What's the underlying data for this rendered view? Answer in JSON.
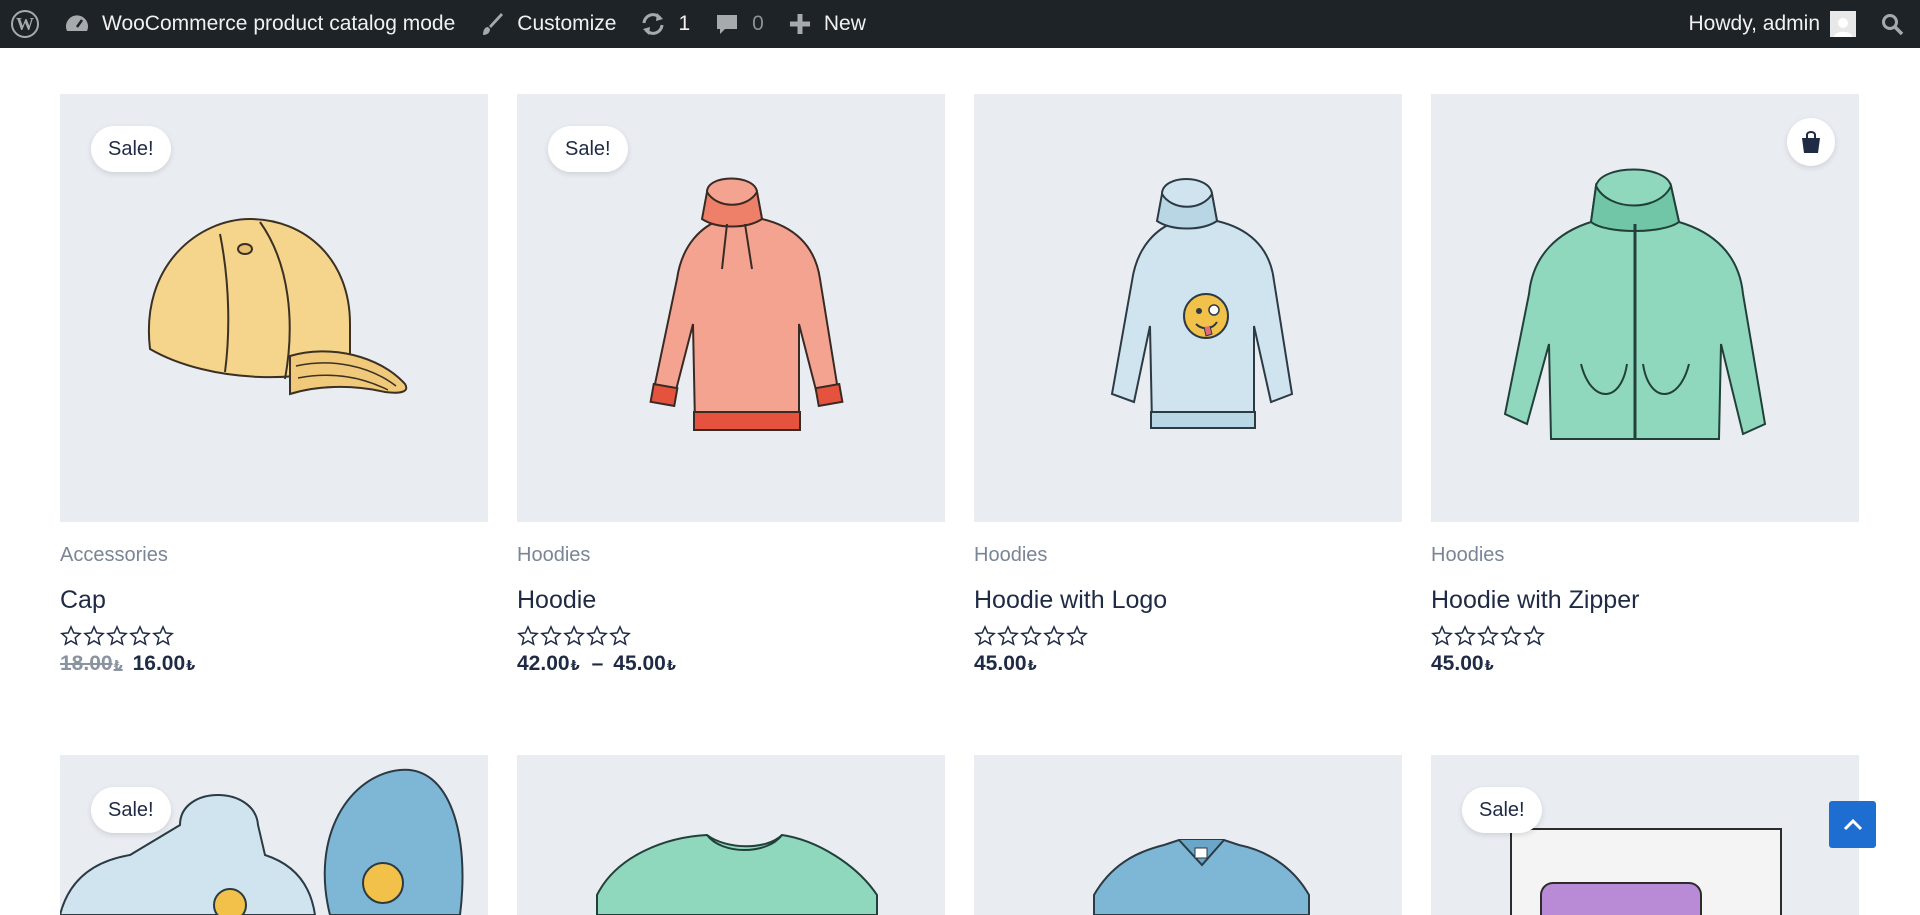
{
  "adminbar": {
    "site_name": "WooCommerce product catalog mode",
    "customize": "Customize",
    "updates_count": "1",
    "comments_count": "0",
    "new_label": "New",
    "howdy": "Howdy, admin"
  },
  "products": [
    {
      "category": "Accessories",
      "title": "Cap",
      "badge": "Sale!",
      "price_old": "18.00",
      "price": "16.00",
      "currency": "₺"
    },
    {
      "category": "Hoodies",
      "title": "Hoodie",
      "badge": "Sale!",
      "price_from": "42.00",
      "price_dash": "–",
      "price_to": "45.00",
      "currency": "₺"
    },
    {
      "category": "Hoodies",
      "title": "Hoodie with Logo",
      "price": "45.00",
      "currency": "₺"
    },
    {
      "category": "Hoodies",
      "title": "Hoodie with Zipper",
      "price": "45.00",
      "currency": "₺"
    }
  ],
  "row2": [
    {
      "badge": "Sale!"
    },
    {},
    {},
    {
      "badge": "Sale!"
    }
  ],
  "colors": {
    "adminbar_bg": "#1d2327",
    "thumb_bg": "#e9edf2",
    "scrolltop": "#1e6ed2",
    "text": "#1f2a44"
  },
  "icons": [
    "wordpress-icon",
    "dashboard-icon",
    "brush-icon",
    "refresh-icon",
    "comment-icon",
    "plus-icon",
    "search-icon",
    "cart-icon",
    "star-icon",
    "chevron-up-icon"
  ]
}
